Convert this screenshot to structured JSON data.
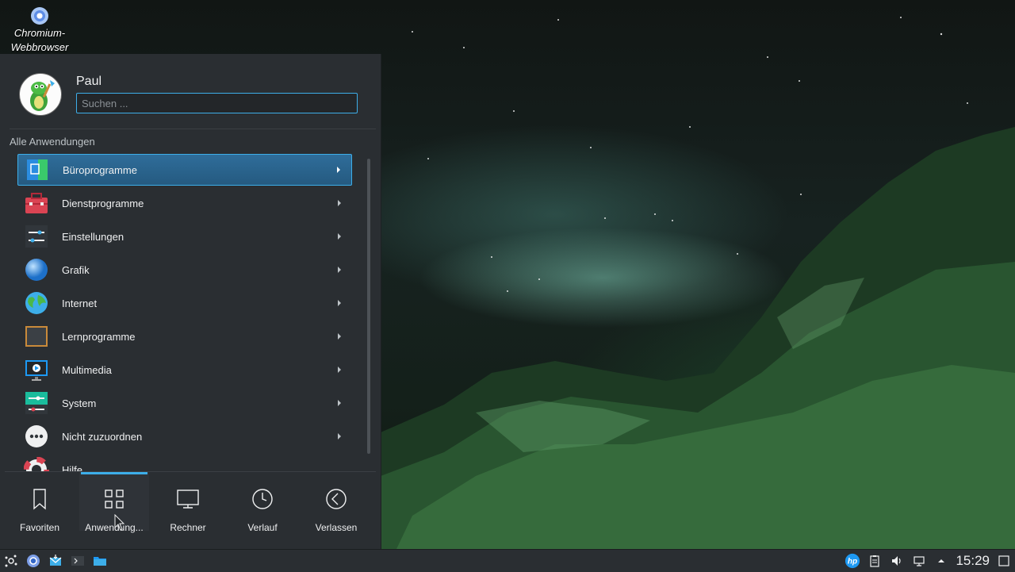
{
  "desktop": {
    "icon_label": "Chromium-\nWebbrowser",
    "icon_line1": "Chromium-",
    "icon_line2": "Webbrowser"
  },
  "launcher": {
    "user_name": "Paul",
    "search_placeholder": "Suchen ...",
    "section_title": "Alle Anwendungen",
    "items": [
      {
        "label": "Büroprogramme",
        "icon": "office-icon",
        "selected": true
      },
      {
        "label": "Dienstprogramme",
        "icon": "toolbox-icon",
        "selected": false
      },
      {
        "label": "Einstellungen",
        "icon": "settings-sliders-icon",
        "selected": false
      },
      {
        "label": "Grafik",
        "icon": "graphics-sphere-icon",
        "selected": false
      },
      {
        "label": "Internet",
        "icon": "globe-icon",
        "selected": false
      },
      {
        "label": "Lernprogramme",
        "icon": "blackboard-icon",
        "selected": false
      },
      {
        "label": "Multimedia",
        "icon": "media-player-icon",
        "selected": false
      },
      {
        "label": "System",
        "icon": "system-icon",
        "selected": false
      },
      {
        "label": "Nicht zuzuordnen",
        "icon": "more-dots-icon",
        "selected": false
      },
      {
        "label": "Hilfe",
        "icon": "lifebuoy-icon",
        "selected": false
      }
    ],
    "tabs": [
      {
        "label": "Favoriten",
        "icon": "bookmark-icon",
        "active": false
      },
      {
        "label": "Anwendung...",
        "icon": "grid-icon",
        "active": true
      },
      {
        "label": "Rechner",
        "icon": "monitor-icon",
        "active": false
      },
      {
        "label": "Verlauf",
        "icon": "clock-icon",
        "active": false
      },
      {
        "label": "Verlassen",
        "icon": "back-arrow-icon",
        "active": false
      }
    ]
  },
  "taskbar": {
    "clock": "15:29",
    "left_icons": [
      "app-launcher-icon",
      "chromium-icon",
      "mail-icon",
      "terminal-icon",
      "file-manager-icon"
    ],
    "tray_icons": [
      "hp-icon",
      "clipboard-icon",
      "volume-icon",
      "network-icon",
      "expand-tray-icon",
      "show-desktop-icon"
    ]
  },
  "colors": {
    "accent": "#3daee9",
    "panel": "#2a2e32",
    "text": "#eff0f1"
  }
}
